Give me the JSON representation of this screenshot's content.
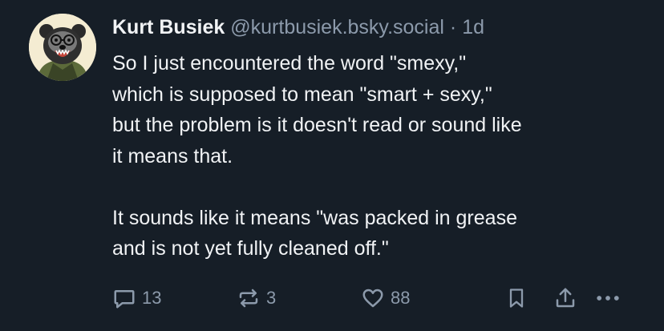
{
  "post": {
    "author_name": "Kurt Busiek",
    "handle": "@kurtbusiek.bsky.social",
    "separator": "·",
    "time": "1d",
    "text_lines": [
      "So I just encountered the word \"smexy,\"",
      "which is supposed to mean \"smart + sexy,\"",
      "but the problem is it doesn't read or sound like",
      "it means that.",
      "It sounds like it means \"was packed in grease",
      "and is not yet fully cleaned off.\""
    ]
  },
  "actions": {
    "reply_count": "13",
    "repost_count": "3",
    "like_count": "88"
  },
  "icons": {
    "reply": "speech-bubble-icon",
    "repost": "repost-arrows-icon",
    "like": "heart-icon",
    "bookmark": "bookmark-icon",
    "share": "share-upload-icon",
    "more": "ellipsis-icon"
  },
  "colors": {
    "background": "#161e27",
    "text": "#f1f3f5",
    "muted": "#8c9aab",
    "avatar_bg": "#f4ecd2"
  }
}
